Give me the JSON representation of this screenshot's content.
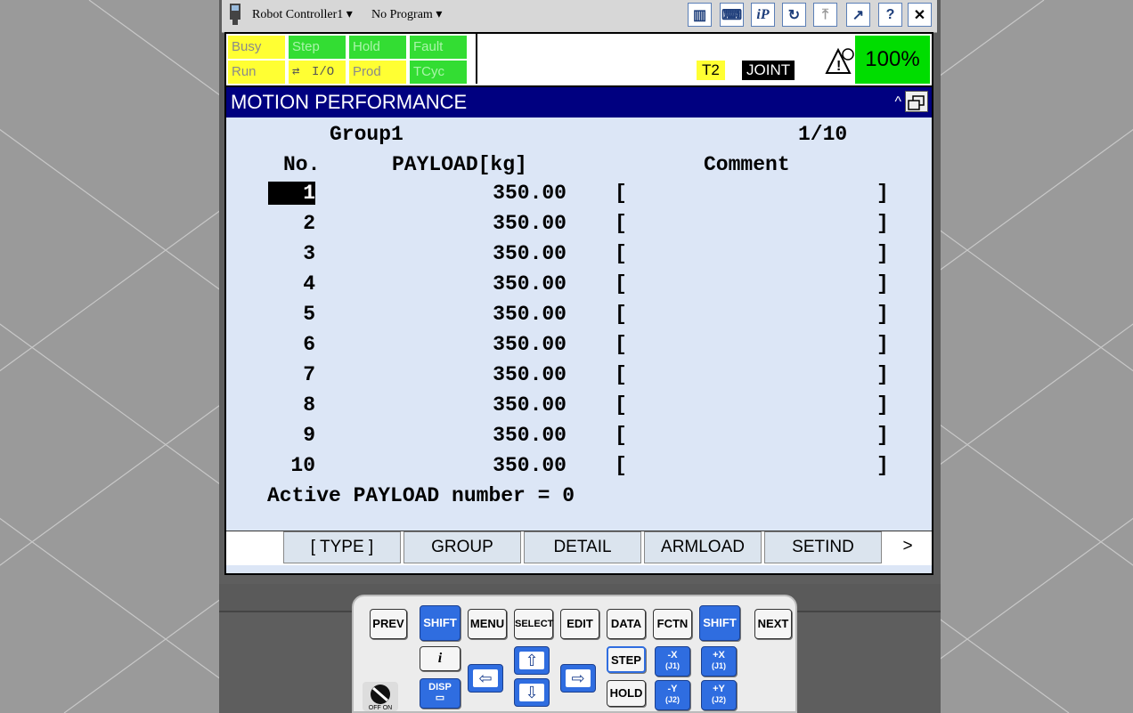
{
  "titlebar": {
    "controller": "Robot Controller1",
    "program": "No Program"
  },
  "status": {
    "leds": [
      "Busy",
      "Step",
      "Hold",
      "Fault",
      "Run",
      "I/O",
      "Prod",
      "TCyc"
    ],
    "mode": "T2",
    "coord": "JOINT",
    "override": "100%"
  },
  "panel": {
    "title": "MOTION PERFORMANCE",
    "group": "Group1",
    "page": "1/10",
    "col_no": "No.",
    "col_payload": "PAYLOAD[kg]",
    "col_comment": "Comment",
    "rows": [
      {
        "no": "1",
        "payload": "350.00"
      },
      {
        "no": "2",
        "payload": "350.00"
      },
      {
        "no": "3",
        "payload": "350.00"
      },
      {
        "no": "4",
        "payload": "350.00"
      },
      {
        "no": "5",
        "payload": "350.00"
      },
      {
        "no": "6",
        "payload": "350.00"
      },
      {
        "no": "7",
        "payload": "350.00"
      },
      {
        "no": "8",
        "payload": "350.00"
      },
      {
        "no": "9",
        "payload": "350.00"
      },
      {
        "no": "10",
        "payload": "350.00"
      }
    ],
    "bracket_left": "[",
    "bracket_right": "]",
    "active": "Active PAYLOAD number = 0"
  },
  "fkeys": [
    "[ TYPE ]",
    "GROUP",
    "DETAIL",
    "ARMLOAD",
    "SETIND",
    ">"
  ],
  "keypad": {
    "prev": "PREV",
    "shift": "SHIFT",
    "menu": "MENU",
    "select": "SELECT",
    "edit": "EDIT",
    "data": "DATA",
    "fctn": "FCTN",
    "next": "NEXT",
    "step": "STEP",
    "hold": "HOLD",
    "disp": "DISP",
    "info": "i",
    "mx": "-X",
    "px": "+X",
    "j1": "(J1)",
    "my": "-Y",
    "py": "+Y",
    "j2": "(J2)",
    "offon": "OFF ON"
  }
}
